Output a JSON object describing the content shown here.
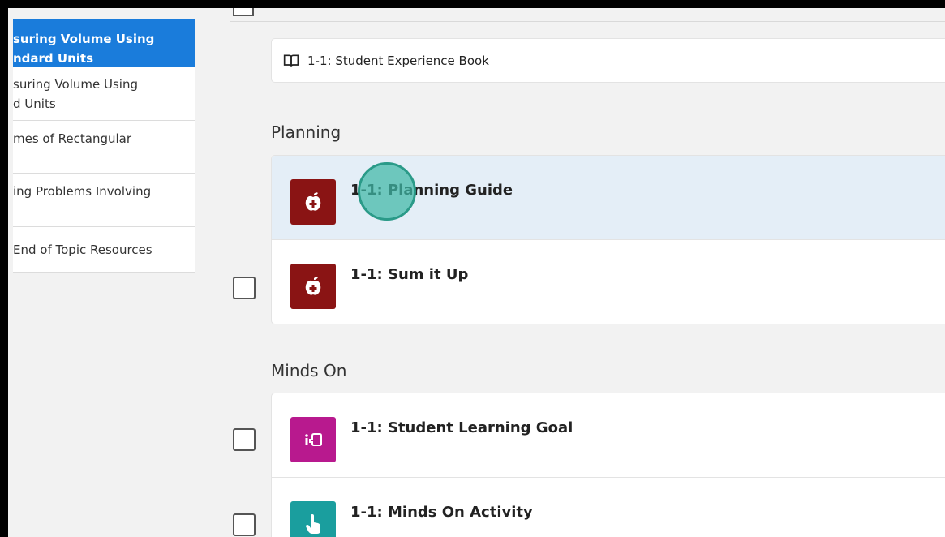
{
  "sidebar": {
    "items": [
      {
        "line1": "suring Volume Using",
        "line2": "ndard Units",
        "active": true
      },
      {
        "line1": "suring Volume Using",
        "line2": "d Units",
        "active": false
      },
      {
        "line1": "mes of Rectangular",
        "line2": "",
        "active": false
      },
      {
        "line1": "ing Problems Involving",
        "line2": "",
        "active": false
      },
      {
        "line1": "End of Topic Resources",
        "line2": "",
        "active": false
      }
    ]
  },
  "main": {
    "book_label": "1-1: Student Experience Book",
    "sections": [
      {
        "title": "Planning",
        "rows": [
          {
            "label": "1-1: Planning Guide",
            "icon": "apple-icon",
            "color": "#8a1414",
            "highlighted": true
          },
          {
            "label": "1-1: Sum it Up",
            "icon": "apple-icon",
            "color": "#8a1414",
            "highlighted": false
          }
        ]
      },
      {
        "title": "Minds On",
        "rows": [
          {
            "label": "1-1: Student Learning Goal",
            "icon": "learning-goal-icon",
            "color": "#b8198e",
            "highlighted": false
          },
          {
            "label": "1-1: Minds On Activity",
            "icon": "pointing-hand-icon",
            "color": "#1a9e9e",
            "highlighted": false
          }
        ]
      }
    ]
  },
  "colors": {
    "accent": "#1a7cdb",
    "cursor": "#3eb8a6"
  }
}
